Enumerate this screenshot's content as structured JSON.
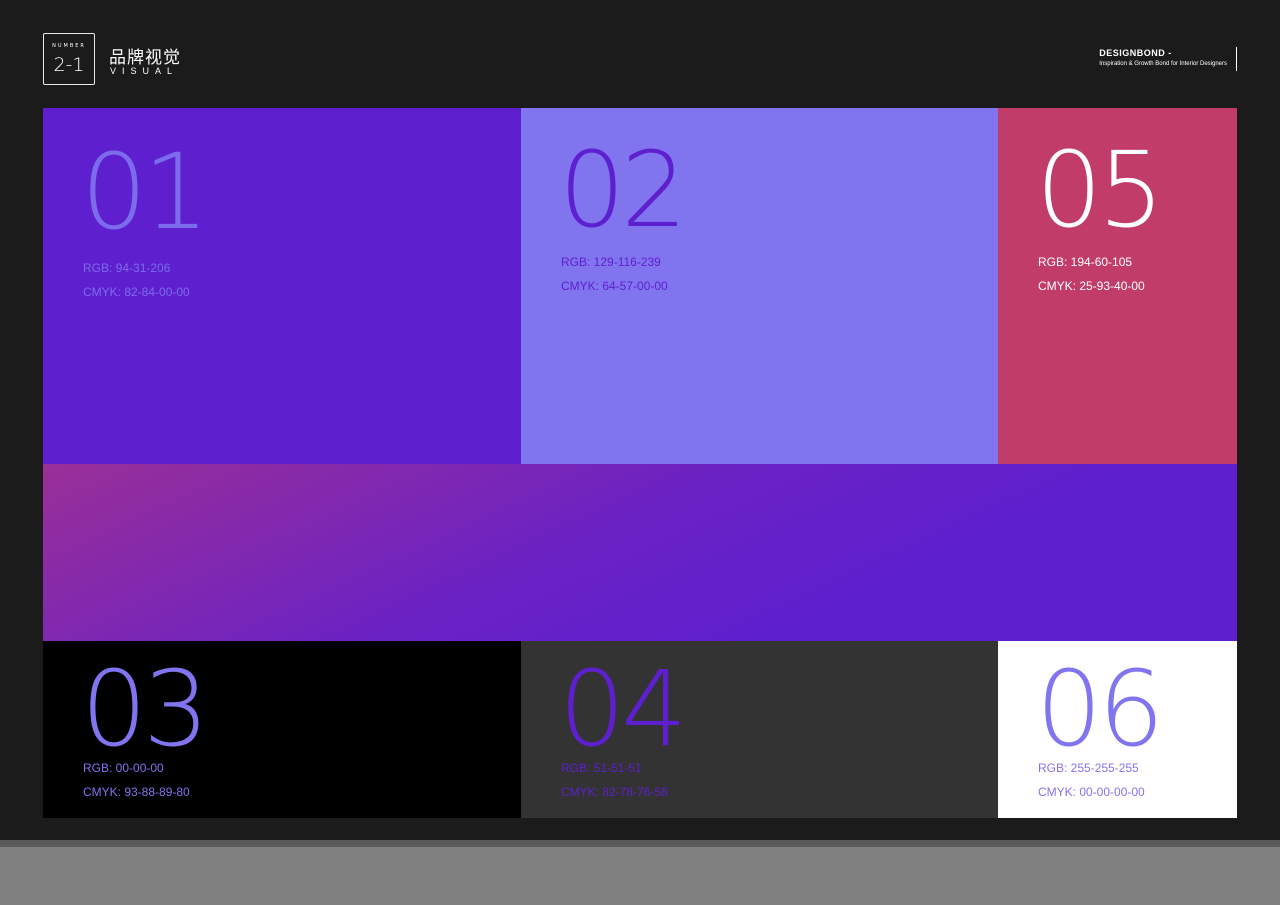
{
  "header": {
    "badge_small": "NUMBER",
    "badge_number": "2-1",
    "title": "品牌视觉",
    "subtitle": "VISUAL"
  },
  "brand": {
    "name": "DESIGNBOND -",
    "tagline": "Inspiration & Growth Bond for Interior Designers"
  },
  "swatches": [
    {
      "num": "01",
      "rgb": "RGB: 94-31-206",
      "cmyk": "CMYK: 82-84-00-00",
      "bg": "#5e1fce",
      "num_color": "#7c6cec",
      "text_color": "#7c6cec"
    },
    {
      "num": "02",
      "rgb": "RGB: 129-116-239",
      "cmyk": "CMYK: 64-57-00-00",
      "bg": "#8174ef",
      "num_color": "#5e1fce",
      "text_color": "#5e1fce"
    },
    {
      "num": "05",
      "rgb": "RGB: 194-60-105",
      "cmyk": "CMYK: 25-93-40-00",
      "bg": "#c23c69",
      "num_color": "#ffffff",
      "text_color": "#ffffff"
    },
    {
      "num": "03",
      "rgb": "RGB: 00-00-00",
      "cmyk": "CMYK: 93-88-89-80",
      "bg": "#000000",
      "num_color": "#8174ef",
      "text_color": "#8174ef"
    },
    {
      "num": "04",
      "rgb": "RGB: 51-51-51",
      "cmyk": "CMYK: 82-78-76-58",
      "bg": "#333333",
      "num_color": "#5e1fce",
      "text_color": "#5e1fce"
    },
    {
      "num": "06",
      "rgb": "RGB: 255-255-255",
      "cmyk": "CMYK: 00-00-00-00",
      "bg": "#ffffff",
      "num_color": "#8174ef",
      "text_color": "#8174ef"
    }
  ],
  "gradient": {
    "from": "#9a2f98",
    "to": "#5e1fce"
  }
}
